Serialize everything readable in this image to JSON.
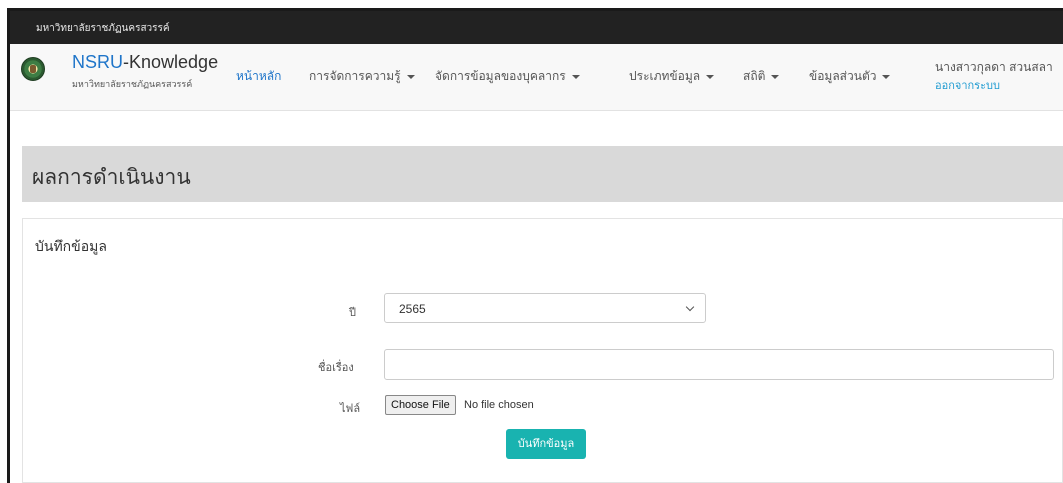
{
  "topbar": {
    "title": "มหาวิทยาลัยราชภัฏนครสวรรค์"
  },
  "brand": {
    "name_prefix": "NSRU",
    "name_suffix": "-Knowledge",
    "subtitle": "มหาวิทยาลัยราชภัฏนครสวรรค์"
  },
  "nav": {
    "items": [
      {
        "label": "หน้าหลัก",
        "active": true,
        "dropdown": false
      },
      {
        "label": "การจัดการความรู้",
        "active": false,
        "dropdown": true
      },
      {
        "label": "จัดการข้อมูลของบุคลากร",
        "active": false,
        "dropdown": true
      },
      {
        "label": "ประเภทข้อมูล",
        "active": false,
        "dropdown": true
      },
      {
        "label": "สถิติ",
        "active": false,
        "dropdown": true
      },
      {
        "label": "ข้อมูลส่วนตัว",
        "active": false,
        "dropdown": true
      }
    ]
  },
  "user": {
    "name": "นางสาวกุลดา สวนสลา",
    "logout_label": "ออกจากระบบ"
  },
  "page": {
    "title": "ผลการดำเนินงาน"
  },
  "form": {
    "panel_title": "บันทึกข้อมูล",
    "year_label": "ปี",
    "year_value": "2565",
    "subject_label": "ชื่อเรื่อง",
    "subject_value": "",
    "file_label": "ไฟล์",
    "file_button": "Choose File",
    "file_status": "No file chosen",
    "submit_label": "บันทึกข้อมูล"
  },
  "colors": {
    "brand_blue": "#1f75c9",
    "submit_teal": "#19b3b0",
    "topbar": "#222222",
    "header_gray": "#d9d9d9"
  }
}
